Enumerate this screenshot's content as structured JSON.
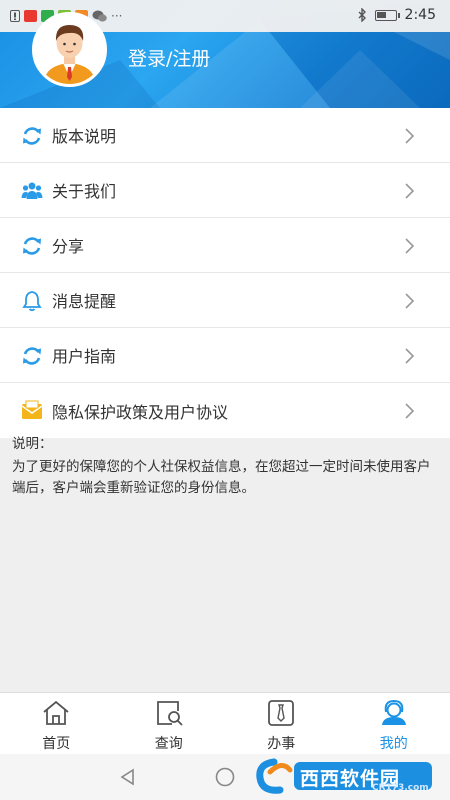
{
  "status_bar": {
    "time": "2:45"
  },
  "header": {
    "login_label": "登录/注册"
  },
  "menu": {
    "items": [
      {
        "label": "版本说明",
        "icon": "refresh-icon"
      },
      {
        "label": "关于我们",
        "icon": "people-icon"
      },
      {
        "label": "分享",
        "icon": "refresh-icon"
      },
      {
        "label": "消息提醒",
        "icon": "bell-icon"
      },
      {
        "label": "用户指南",
        "icon": "refresh-icon"
      },
      {
        "label": "隐私保护政策及用户协议",
        "icon": "envelope-icon"
      }
    ]
  },
  "note": {
    "title": "说明：",
    "text": "为了更好的保障您的个人社保权益信息，在您超过一定时间未使用客户端后，客户端会重新验证您的身份信息。"
  },
  "tabs": [
    {
      "label": "首页",
      "icon": "home-icon",
      "active": false
    },
    {
      "label": "查询",
      "icon": "search-icon",
      "active": false
    },
    {
      "label": "办事",
      "icon": "tie-icon",
      "active": false
    },
    {
      "label": "我的",
      "icon": "user-icon",
      "active": true
    }
  ],
  "watermark": {
    "text": "西西软件园",
    "sub": "CR173.com"
  },
  "colors": {
    "accent": "#1a92e6",
    "header": "#1a8fe3",
    "envelope": "#f3b51a"
  }
}
